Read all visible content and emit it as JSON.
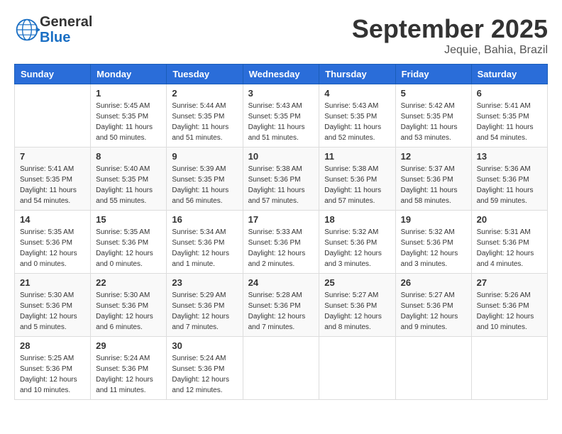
{
  "header": {
    "logo_general": "General",
    "logo_blue": "Blue",
    "month_title": "September 2025",
    "location": "Jequie, Bahia, Brazil"
  },
  "days_of_week": [
    "Sunday",
    "Monday",
    "Tuesday",
    "Wednesday",
    "Thursday",
    "Friday",
    "Saturday"
  ],
  "weeks": [
    [
      {
        "day": "",
        "info": ""
      },
      {
        "day": "1",
        "info": "Sunrise: 5:45 AM\nSunset: 5:35 PM\nDaylight: 11 hours\nand 50 minutes."
      },
      {
        "day": "2",
        "info": "Sunrise: 5:44 AM\nSunset: 5:35 PM\nDaylight: 11 hours\nand 51 minutes."
      },
      {
        "day": "3",
        "info": "Sunrise: 5:43 AM\nSunset: 5:35 PM\nDaylight: 11 hours\nand 51 minutes."
      },
      {
        "day": "4",
        "info": "Sunrise: 5:43 AM\nSunset: 5:35 PM\nDaylight: 11 hours\nand 52 minutes."
      },
      {
        "day": "5",
        "info": "Sunrise: 5:42 AM\nSunset: 5:35 PM\nDaylight: 11 hours\nand 53 minutes."
      },
      {
        "day": "6",
        "info": "Sunrise: 5:41 AM\nSunset: 5:35 PM\nDaylight: 11 hours\nand 54 minutes."
      }
    ],
    [
      {
        "day": "7",
        "info": "Sunrise: 5:41 AM\nSunset: 5:35 PM\nDaylight: 11 hours\nand 54 minutes."
      },
      {
        "day": "8",
        "info": "Sunrise: 5:40 AM\nSunset: 5:35 PM\nDaylight: 11 hours\nand 55 minutes."
      },
      {
        "day": "9",
        "info": "Sunrise: 5:39 AM\nSunset: 5:35 PM\nDaylight: 11 hours\nand 56 minutes."
      },
      {
        "day": "10",
        "info": "Sunrise: 5:38 AM\nSunset: 5:36 PM\nDaylight: 11 hours\nand 57 minutes."
      },
      {
        "day": "11",
        "info": "Sunrise: 5:38 AM\nSunset: 5:36 PM\nDaylight: 11 hours\nand 57 minutes."
      },
      {
        "day": "12",
        "info": "Sunrise: 5:37 AM\nSunset: 5:36 PM\nDaylight: 11 hours\nand 58 minutes."
      },
      {
        "day": "13",
        "info": "Sunrise: 5:36 AM\nSunset: 5:36 PM\nDaylight: 11 hours\nand 59 minutes."
      }
    ],
    [
      {
        "day": "14",
        "info": "Sunrise: 5:35 AM\nSunset: 5:36 PM\nDaylight: 12 hours\nand 0 minutes."
      },
      {
        "day": "15",
        "info": "Sunrise: 5:35 AM\nSunset: 5:36 PM\nDaylight: 12 hours\nand 0 minutes."
      },
      {
        "day": "16",
        "info": "Sunrise: 5:34 AM\nSunset: 5:36 PM\nDaylight: 12 hours\nand 1 minute."
      },
      {
        "day": "17",
        "info": "Sunrise: 5:33 AM\nSunset: 5:36 PM\nDaylight: 12 hours\nand 2 minutes."
      },
      {
        "day": "18",
        "info": "Sunrise: 5:32 AM\nSunset: 5:36 PM\nDaylight: 12 hours\nand 3 minutes."
      },
      {
        "day": "19",
        "info": "Sunrise: 5:32 AM\nSunset: 5:36 PM\nDaylight: 12 hours\nand 3 minutes."
      },
      {
        "day": "20",
        "info": "Sunrise: 5:31 AM\nSunset: 5:36 PM\nDaylight: 12 hours\nand 4 minutes."
      }
    ],
    [
      {
        "day": "21",
        "info": "Sunrise: 5:30 AM\nSunset: 5:36 PM\nDaylight: 12 hours\nand 5 minutes."
      },
      {
        "day": "22",
        "info": "Sunrise: 5:30 AM\nSunset: 5:36 PM\nDaylight: 12 hours\nand 6 minutes."
      },
      {
        "day": "23",
        "info": "Sunrise: 5:29 AM\nSunset: 5:36 PM\nDaylight: 12 hours\nand 7 minutes."
      },
      {
        "day": "24",
        "info": "Sunrise: 5:28 AM\nSunset: 5:36 PM\nDaylight: 12 hours\nand 7 minutes."
      },
      {
        "day": "25",
        "info": "Sunrise: 5:27 AM\nSunset: 5:36 PM\nDaylight: 12 hours\nand 8 minutes."
      },
      {
        "day": "26",
        "info": "Sunrise: 5:27 AM\nSunset: 5:36 PM\nDaylight: 12 hours\nand 9 minutes."
      },
      {
        "day": "27",
        "info": "Sunrise: 5:26 AM\nSunset: 5:36 PM\nDaylight: 12 hours\nand 10 minutes."
      }
    ],
    [
      {
        "day": "28",
        "info": "Sunrise: 5:25 AM\nSunset: 5:36 PM\nDaylight: 12 hours\nand 10 minutes."
      },
      {
        "day": "29",
        "info": "Sunrise: 5:24 AM\nSunset: 5:36 PM\nDaylight: 12 hours\nand 11 minutes."
      },
      {
        "day": "30",
        "info": "Sunrise: 5:24 AM\nSunset: 5:36 PM\nDaylight: 12 hours\nand 12 minutes."
      },
      {
        "day": "",
        "info": ""
      },
      {
        "day": "",
        "info": ""
      },
      {
        "day": "",
        "info": ""
      },
      {
        "day": "",
        "info": ""
      }
    ]
  ]
}
